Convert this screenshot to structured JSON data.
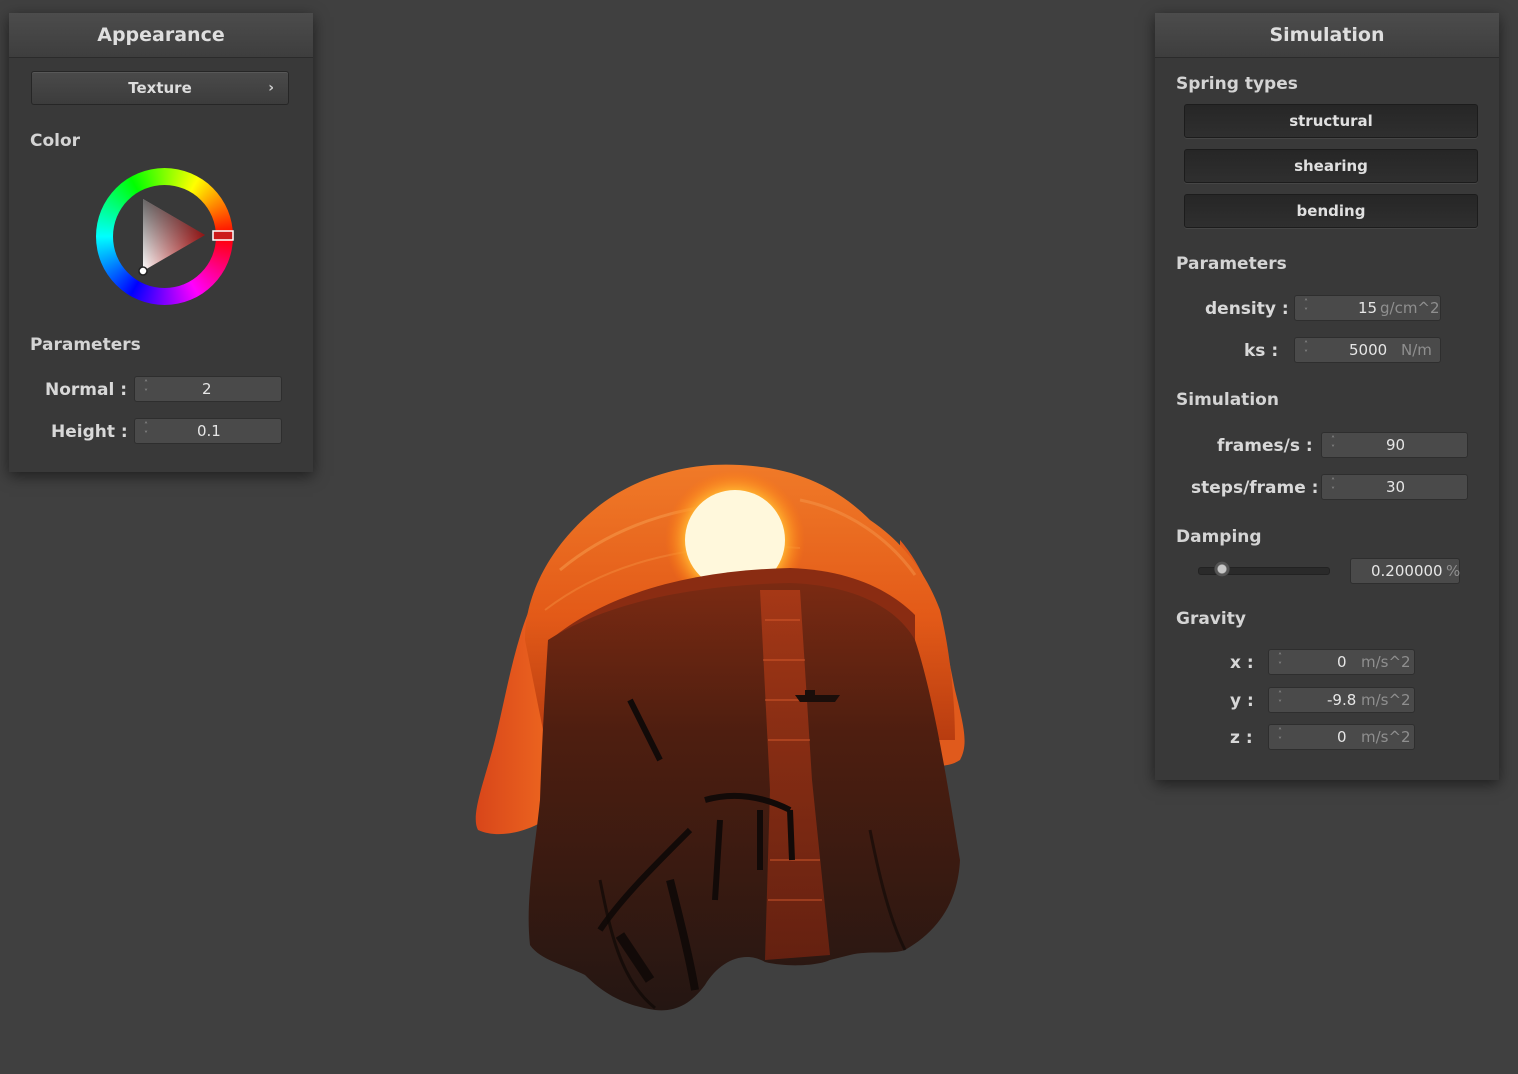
{
  "appearance": {
    "title": "Appearance",
    "texture_button": "Texture",
    "color_section": "Color",
    "parameters_section": "Parameters",
    "normal_label": "Normal :",
    "normal_value": "2",
    "height_label": "Height :",
    "height_value": "0.1",
    "selected_color": "#cc2222"
  },
  "simulation": {
    "title": "Simulation",
    "spring_types_section": "Spring types",
    "spring_types": [
      "structural",
      "shearing",
      "bending"
    ],
    "parameters_section": "Parameters",
    "density_label": "density :",
    "density_value": "15",
    "density_unit": "g/cm^2",
    "ks_label": "ks :",
    "ks_value": "5000",
    "ks_unit": "N/m",
    "simulation_section": "Simulation",
    "fps_label": "frames/s :",
    "fps_value": "90",
    "steps_label": "steps/frame :",
    "steps_value": "30",
    "damping_section": "Damping",
    "damping_value": "0.200000",
    "damping_unit": "%",
    "damping_fraction": 0.2,
    "gravity_section": "Gravity",
    "gx_label": "x :",
    "gx_value": "0",
    "gy_label": "y :",
    "gy_value": "-9.8",
    "gz_label": "z :",
    "gz_value": "0",
    "gravity_unit": "m/s^2"
  },
  "colors": {
    "background": "#404040",
    "panel": "#393939",
    "cloth_orange": "#e0521a",
    "sun": "#fff2c0"
  }
}
